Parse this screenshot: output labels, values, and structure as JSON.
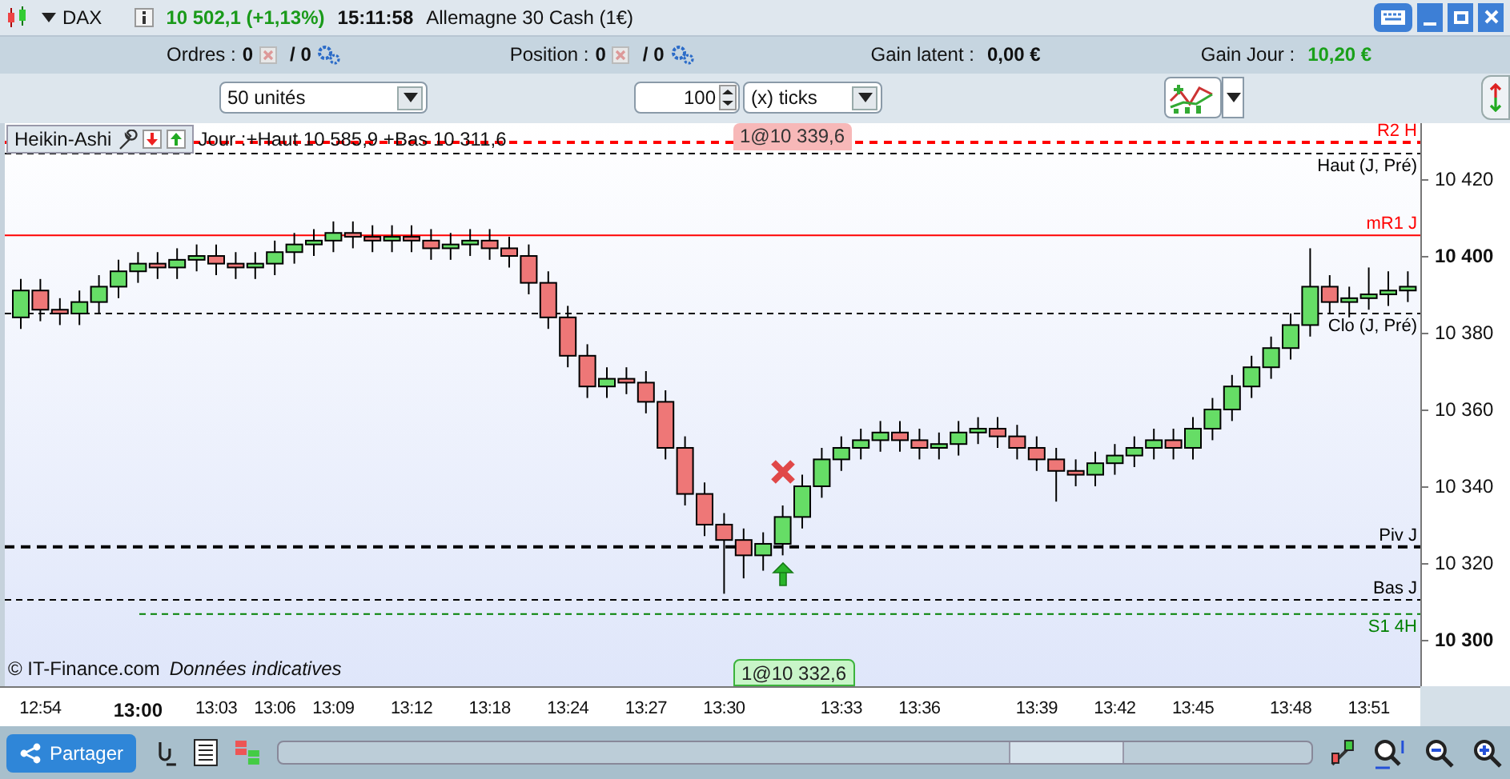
{
  "title_bar": {
    "instrument": "DAX",
    "quote": "10 502,1 (+1,13%)",
    "time": "15:11:58",
    "name": "Allemagne 30 Cash (1€)"
  },
  "summary": [
    {
      "label": "Ordres :",
      "count": "0",
      "total": "/ 0",
      "kind": "count"
    },
    {
      "label": "Position :",
      "count": "0",
      "total": "/ 0",
      "kind": "count"
    },
    {
      "label": "Gain latent :",
      "value": "0,00 €",
      "kind": "plain"
    },
    {
      "label": "Gain Jour :",
      "value": "10,20 €",
      "kind": "gain"
    }
  ],
  "order_bar": {
    "quantity": "50 unités",
    "distance": "100",
    "unit": "(x) ticks"
  },
  "chart": {
    "info": "Jour :+Haut 10 585,9 +Bas 10 311,6",
    "copyright": "© IT-Finance.com",
    "notice": "Données indicatives",
    "tags": [
      {
        "text": "1@10 339,6",
        "kind": "sell"
      },
      {
        "text": "1@10 332,6",
        "kind": "buy"
      }
    ],
    "chart_data": {
      "type": "candlestick",
      "title": "Heikin-Ashi",
      "ylim": [
        10287.9,
        10434.6
      ],
      "categories": [
        null,
        "12:54",
        null,
        null,
        null,
        null,
        "13:00",
        null,
        null,
        null,
        "13:03",
        null,
        null,
        "13:06",
        null,
        null,
        "13:09",
        null,
        null,
        null,
        "13:12",
        null,
        null,
        null,
        "13:18",
        null,
        null,
        null,
        "13:24",
        null,
        null,
        null,
        "13:27",
        null,
        null,
        null,
        "13:30",
        null,
        null,
        null,
        null,
        null,
        "13:33",
        null,
        null,
        null,
        "13:36",
        null,
        null,
        null,
        null,
        null,
        "13:39",
        null,
        null,
        null,
        "13:42",
        null,
        null,
        null,
        "13:45",
        null,
        null,
        null,
        null,
        "13:48",
        null,
        null,
        null,
        "13:51",
        null,
        null
      ],
      "ohlc": [
        [
          10384,
          10394,
          10381,
          10391
        ],
        [
          10391,
          10394,
          10383,
          10386
        ],
        [
          10386,
          10389,
          10382,
          10385
        ],
        [
          10385,
          10391,
          10382,
          10388
        ],
        [
          10388,
          10395,
          10385,
          10392
        ],
        [
          10392,
          10399,
          10389,
          10396
        ],
        [
          10396,
          10401,
          10393,
          10398
        ],
        [
          10398,
          10401,
          10394,
          10397
        ],
        [
          10397,
          10402,
          10394,
          10399
        ],
        [
          10399,
          10403,
          10396,
          10400
        ],
        [
          10400,
          10403,
          10395,
          10398
        ],
        [
          10398,
          10401,
          10394,
          10397
        ],
        [
          10397,
          10401,
          10394,
          10398
        ],
        [
          10398,
          10404,
          10395,
          10401
        ],
        [
          10401,
          10406,
          10398,
          10403
        ],
        [
          10403,
          10407,
          10400,
          10404
        ],
        [
          10404,
          10409,
          10401,
          10406
        ],
        [
          10406,
          10409,
          10402,
          10405
        ],
        [
          10405,
          10408,
          10401,
          10404
        ],
        [
          10404,
          10408,
          10401,
          10405
        ],
        [
          10405,
          10408,
          10401,
          10404
        ],
        [
          10404,
          10407,
          10399,
          10402
        ],
        [
          10402,
          10406,
          10399,
          10403
        ],
        [
          10403,
          10407,
          10400,
          10404
        ],
        [
          10404,
          10407,
          10399,
          10402
        ],
        [
          10402,
          10405,
          10397,
          10400
        ],
        [
          10400,
          10403,
          10390,
          10393
        ],
        [
          10393,
          10396,
          10381,
          10384
        ],
        [
          10384,
          10387,
          10371,
          10374
        ],
        [
          10374,
          10377,
          10363,
          10366
        ],
        [
          10366,
          10371,
          10363,
          10368
        ],
        [
          10368,
          10371,
          10364,
          10367
        ],
        [
          10367,
          10370,
          10359,
          10362
        ],
        [
          10362,
          10365,
          10347,
          10350
        ],
        [
          10350,
          10353,
          10335,
          10338
        ],
        [
          10338,
          10341,
          10327,
          10330
        ],
        [
          10330,
          10333,
          10312,
          10326
        ],
        [
          10326,
          10329,
          10316,
          10322
        ],
        [
          10322,
          10328,
          10318,
          10325
        ],
        [
          10325,
          10335,
          10322,
          10332
        ],
        [
          10332,
          10343,
          10329,
          10340
        ],
        [
          10340,
          10350,
          10337,
          10347
        ],
        [
          10347,
          10353,
          10344,
          10350
        ],
        [
          10350,
          10355,
          10347,
          10352
        ],
        [
          10352,
          10357,
          10349,
          10354
        ],
        [
          10354,
          10357,
          10349,
          10352
        ],
        [
          10352,
          10355,
          10347,
          10350
        ],
        [
          10350,
          10354,
          10347,
          10351
        ],
        [
          10351,
          10357,
          10348,
          10354
        ],
        [
          10354,
          10358,
          10351,
          10355
        ],
        [
          10355,
          10358,
          10350,
          10353
        ],
        [
          10353,
          10356,
          10347,
          10350
        ],
        [
          10350,
          10353,
          10344,
          10347
        ],
        [
          10347,
          10350,
          10336,
          10344
        ],
        [
          10344,
          10347,
          10340,
          10343
        ],
        [
          10343,
          10349,
          10340,
          10346
        ],
        [
          10346,
          10351,
          10343,
          10348
        ],
        [
          10348,
          10353,
          10345,
          10350
        ],
        [
          10350,
          10355,
          10347,
          10352
        ],
        [
          10352,
          10355,
          10347,
          10350
        ],
        [
          10350,
          10358,
          10347,
          10355
        ],
        [
          10355,
          10363,
          10352,
          10360
        ],
        [
          10360,
          10369,
          10357,
          10366
        ],
        [
          10366,
          10374,
          10363,
          10371
        ],
        [
          10371,
          10379,
          10368,
          10376
        ],
        [
          10376,
          10385,
          10373,
          10382
        ],
        [
          10382,
          10402,
          10379,
          10392
        ],
        [
          10392,
          10395,
          10385,
          10388
        ],
        [
          10388,
          10392,
          10384,
          10389
        ],
        [
          10389,
          10397,
          10386,
          10390
        ],
        [
          10390,
          10396,
          10387,
          10391
        ],
        [
          10391,
          10396,
          10388,
          10392
        ]
      ],
      "yticks": [
        {
          "value": 10420,
          "label": "10 420"
        },
        {
          "value": 10400,
          "label": "10 400"
        },
        {
          "value": 10380,
          "label": "10 380"
        },
        {
          "value": 10360,
          "label": "10 360"
        },
        {
          "value": 10340,
          "label": "10 340"
        },
        {
          "value": 10320,
          "label": "10 320"
        },
        {
          "value": 10300,
          "label": "10 300"
        }
      ],
      "ref_lines": [
        {
          "axis": "y",
          "value": 10429.6,
          "label": "R2 H",
          "color": "#ff0000"
        },
        {
          "axis": "y",
          "value": 10426.7,
          "label": "Haut (J, Pré)",
          "color": "#000000"
        },
        {
          "axis": "y",
          "value": 10405.4,
          "label": "mR1 J",
          "color": "#ff0000"
        },
        {
          "axis": "y",
          "value": 10385,
          "label": "Clo (J, Pré)",
          "color": "#000000"
        },
        {
          "axis": "y",
          "value": 10324.2,
          "label": "Piv J",
          "color": "#000000"
        },
        {
          "axis": "y",
          "value": 10310.4,
          "label": "Bas J",
          "color": "#000000"
        },
        {
          "axis": "y",
          "value": 10306.7,
          "label": "S1 4H",
          "color": "#008000"
        }
      ]
    }
  },
  "bottom_bar": {
    "share": "Partager"
  }
}
